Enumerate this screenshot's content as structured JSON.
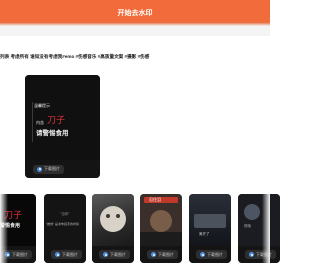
{
  "header": {
    "start_button_label": "开始去水印"
  },
  "caption": {
    "text": "列表 考虑所有 谁知没有考虑我#emo #伤感音乐 #高质量文案 #摄影 #伤感"
  },
  "main_card": {
    "text_lines": [
      "温馨提示",
      "内含",
      "刀子",
      "请警惕食用"
    ],
    "download_label": "下载图片"
  },
  "thumbnails": [
    {
      "lines": [
        "刀子",
        "警惕食用"
      ],
      "download_label": "下载图片",
      "icon": "image-icon"
    },
    {
      "lines": [
        "\"当你\"",
        "\"推倒\" 是冲你招手的时候"
      ],
      "download_label": "下载图片",
      "icon": "image-icon"
    },
    {
      "lines": [],
      "download_label": "下载图片",
      "icon": "image-icon"
    },
    {
      "lines": [
        "忍住泪"
      ],
      "download_label": "下载图片",
      "icon": "image-icon"
    },
    {
      "lines": [
        "离开了"
      ],
      "download_label": "下载图片",
      "icon": "image-icon"
    },
    {
      "lines": [
        "夜晚"
      ],
      "download_label": "下载图片",
      "icon": "image-icon"
    }
  ],
  "colors": {
    "accent": "#f26b3a",
    "card_bg": "#0c0c0c",
    "red_text": "#e3313b",
    "icon_blue": "#4a90e2"
  }
}
